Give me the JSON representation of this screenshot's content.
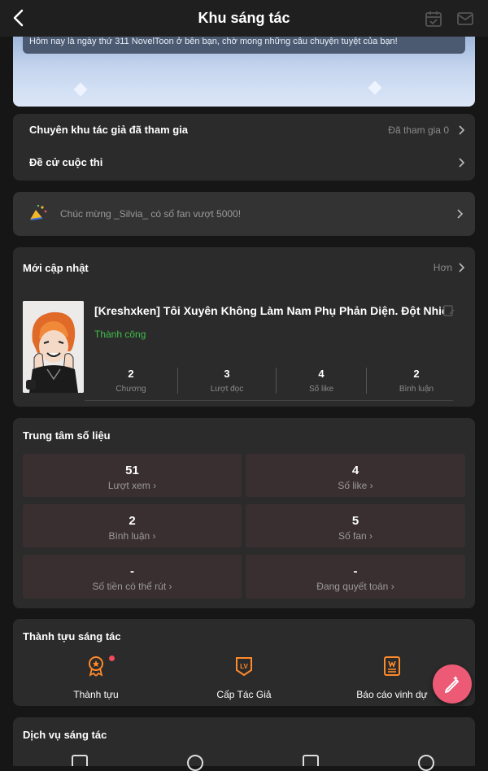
{
  "header": {
    "title": "Khu sáng tác"
  },
  "banner": {
    "message": "Hôm nay là ngày thứ 311 NovelToon ở bên bạn, chờ mong những câu chuyện tuyệt của bạn!"
  },
  "menu": {
    "joined_label": "Chuyên khu tác giả đã tham gia",
    "joined_value": "Đã tham gia 0",
    "contest_label": "Đề cử cuộc thi"
  },
  "notice": {
    "text": "Chúc mừng _Silvia_ có số fan vượt 5000!"
  },
  "recent": {
    "title": "Mới cập nhật",
    "more": "Hơn",
    "book": {
      "title": "[Kreshxken] Tôi Xuyên Không Làm Nam Phụ Phản Diện. Đột Nhiê...",
      "status": "Thành công",
      "stats": [
        {
          "value": "2",
          "label": "Chương"
        },
        {
          "value": "3",
          "label": "Lượt đọc"
        },
        {
          "value": "4",
          "label": "Số like"
        },
        {
          "value": "2",
          "label": "Bình luận"
        }
      ]
    }
  },
  "data_center": {
    "title": "Trung tâm số liệu",
    "cells": [
      {
        "value": "51",
        "label": "Lượt xem"
      },
      {
        "value": "4",
        "label": "Số like"
      },
      {
        "value": "2",
        "label": "Bình luận"
      },
      {
        "value": "5",
        "label": "Số fan"
      },
      {
        "value": "-",
        "label": "Số tiền có thể rút"
      },
      {
        "value": "-",
        "label": "Đang quyết toán"
      }
    ]
  },
  "achievements": {
    "title": "Thành tựu sáng tác",
    "items": [
      {
        "label": "Thành tựu",
        "icon": "medal-icon"
      },
      {
        "label": "Cấp Tác Giả",
        "icon": "level-badge-icon"
      },
      {
        "label": "Báo cáo vinh dự",
        "icon": "honor-report-icon"
      }
    ]
  },
  "services": {
    "title": "Dịch vụ sáng tác"
  },
  "colors": {
    "accent": "#ff8a2a",
    "success": "#3fbf4a",
    "fab": "#ec5a76",
    "stat_bg": "#3a2f30"
  }
}
